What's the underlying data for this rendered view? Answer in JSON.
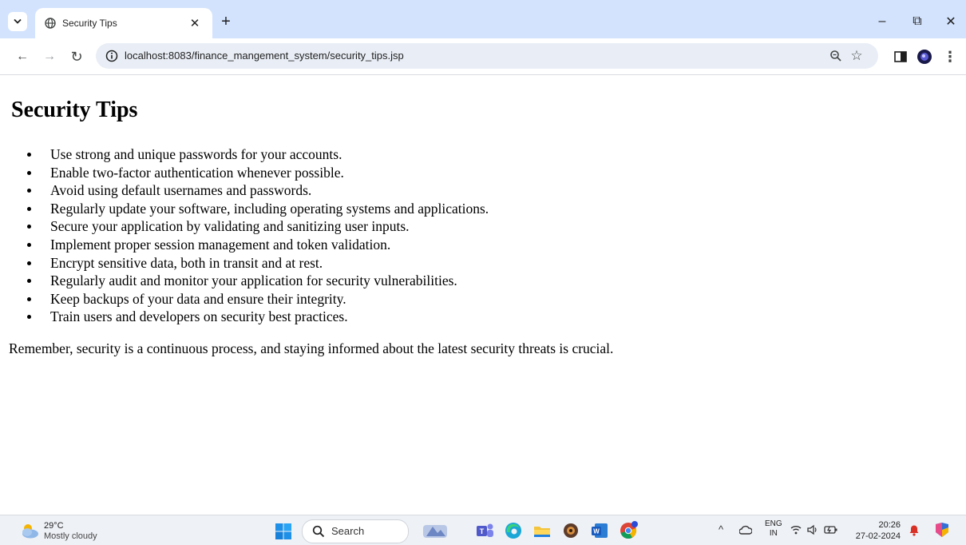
{
  "browser": {
    "tab": {
      "title": "Security Tips",
      "close": "✕",
      "favicon": "globe-icon"
    },
    "new_tab": "+",
    "window_controls": {
      "minimize": "–",
      "restore": "⧉",
      "close": "✕"
    },
    "nav": {
      "back": "←",
      "forward": "→",
      "reload": "↻"
    },
    "url": "localhost:8083/finance_mangement_system/security_tips.jsp"
  },
  "page": {
    "heading": "Security Tips",
    "tips": [
      "Use strong and unique passwords for your accounts.",
      "Enable two-factor authentication whenever possible.",
      "Avoid using default usernames and passwords.",
      "Regularly update your software, including operating systems and applications.",
      "Secure your application by validating and sanitizing user inputs.",
      "Implement proper session management and token validation.",
      "Encrypt sensitive data, both in transit and at rest.",
      "Regularly audit and monitor your application for security vulnerabilities.",
      "Keep backups of your data and ensure their integrity.",
      "Train users and developers on security best practices."
    ],
    "closing": "Remember, security is a continuous process, and staying informed about the latest security threats is crucial."
  },
  "taskbar": {
    "weather": {
      "temp": "29°C",
      "desc": "Mostly cloudy"
    },
    "search_placeholder": "Search",
    "language": {
      "line1": "ENG",
      "line2": "IN"
    },
    "clock": {
      "time": "20:26",
      "date": "27-02-2024"
    },
    "colors": {
      "accent": "#0b57d0",
      "taskbar_bg": "#eef1f6",
      "tab_strip_bg": "#d3e3fd"
    }
  }
}
